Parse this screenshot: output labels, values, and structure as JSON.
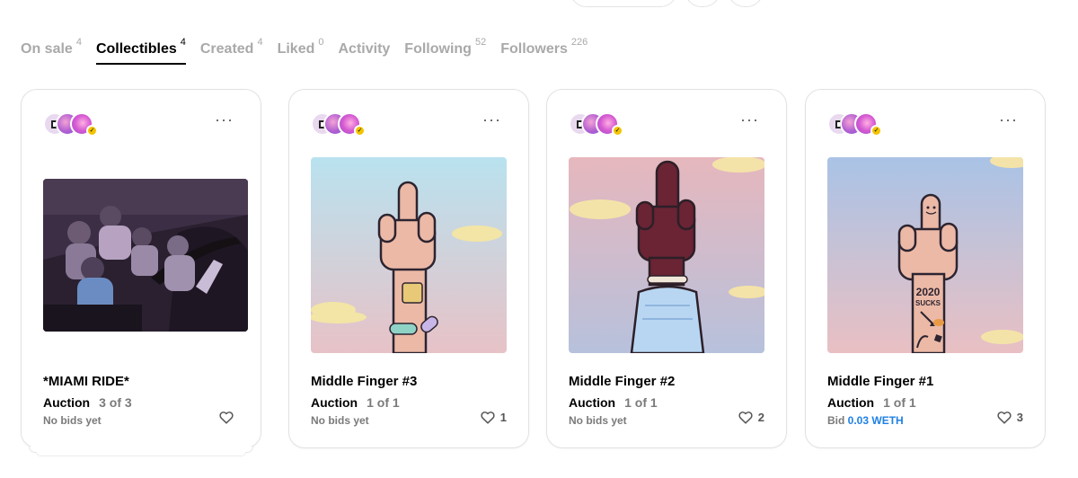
{
  "tabs": [
    {
      "label": "On sale",
      "count": "4",
      "active": false
    },
    {
      "label": "Collectibles",
      "count": "4",
      "active": true
    },
    {
      "label": "Created",
      "count": "4",
      "active": false
    },
    {
      "label": "Liked",
      "count": "0",
      "active": false
    },
    {
      "label": "Activity",
      "count": "",
      "active": false
    },
    {
      "label": "Following",
      "count": "52",
      "active": false
    },
    {
      "label": "Followers",
      "count": "226",
      "active": false
    }
  ],
  "cards": [
    {
      "title": "*MIAMI RIDE*",
      "sale_type": "Auction",
      "edition": "3 of 3",
      "bid_label": "No bids yet",
      "bid_price": "",
      "likes": "",
      "art": "miami-ride-artwork"
    },
    {
      "title": "Middle Finger #3",
      "sale_type": "Auction",
      "edition": "1 of 1",
      "bid_label": "No bids yet",
      "bid_price": "",
      "likes": "1",
      "art": "middle-finger-3-artwork"
    },
    {
      "title": "Middle Finger #2",
      "sale_type": "Auction",
      "edition": "1 of 1",
      "bid_label": "No bids yet",
      "bid_price": "",
      "likes": "2",
      "art": "middle-finger-2-artwork"
    },
    {
      "title": "Middle Finger #1",
      "sale_type": "Auction",
      "edition": "1 of 1",
      "bid_label": "Bid ",
      "bid_price": "0.03 WETH",
      "likes": "3",
      "art": "middle-finger-1-artwork"
    }
  ],
  "art_text": {
    "tattoo_year": "2020",
    "tattoo_word": "SUCKS"
  },
  "colors": {
    "accent_blue": "#2081e2",
    "verified_yellow": "#f2c400",
    "muted_text": "#7a7a7a"
  },
  "icons": {
    "more": "more-options-icon",
    "like": "heart-outline-icon",
    "verified": "verified-badge-icon"
  }
}
